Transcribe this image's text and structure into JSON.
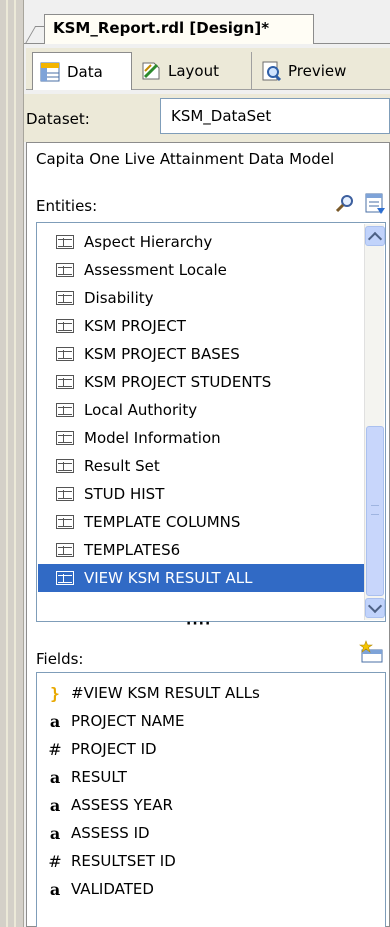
{
  "document_tab": {
    "title": "KSM_Report.rdl [Design]*"
  },
  "view_tabs": [
    {
      "label": "Data",
      "icon": "data-icon",
      "active": true
    },
    {
      "label": "Layout",
      "icon": "layout-icon",
      "active": false
    },
    {
      "label": "Preview",
      "icon": "preview-icon",
      "active": false
    }
  ],
  "dataset": {
    "label": "Dataset:",
    "value": "KSM_DataSet"
  },
  "model_title": "Capita One Live Attainment Data Model",
  "entities": {
    "label": "Entities:",
    "items": [
      {
        "label": "Aspect Hierarchy",
        "selected": false
      },
      {
        "label": "Assessment Locale",
        "selected": false
      },
      {
        "label": "Disability",
        "selected": false
      },
      {
        "label": "KSM PROJECT",
        "selected": false
      },
      {
        "label": "KSM PROJECT BASES",
        "selected": false
      },
      {
        "label": "KSM PROJECT STUDENTS",
        "selected": false
      },
      {
        "label": "Local Authority",
        "selected": false
      },
      {
        "label": "Model Information",
        "selected": false
      },
      {
        "label": "Result Set",
        "selected": false
      },
      {
        "label": "STUD HIST",
        "selected": false
      },
      {
        "label": "TEMPLATE COLUMNS",
        "selected": false
      },
      {
        "label": "TEMPLATES6",
        "selected": false
      },
      {
        "label": "VIEW KSM RESULT ALL",
        "selected": true
      }
    ]
  },
  "splitter": {
    "grip": "····"
  },
  "fields": {
    "label": "Fields:",
    "items": [
      {
        "type_glyph": "}",
        "type": "aggregate",
        "label": "#VIEW KSM RESULT ALLs"
      },
      {
        "type_glyph": "a",
        "type": "text",
        "label": "PROJECT NAME"
      },
      {
        "type_glyph": "#",
        "type": "number",
        "label": "PROJECT ID"
      },
      {
        "type_glyph": "a",
        "type": "text",
        "label": "RESULT"
      },
      {
        "type_glyph": "a",
        "type": "text",
        "label": "ASSESS YEAR"
      },
      {
        "type_glyph": "a",
        "type": "text",
        "label": "ASSESS ID"
      },
      {
        "type_glyph": "#",
        "type": "number",
        "label": "RESULTSET ID"
      },
      {
        "type_glyph": "a",
        "type": "text",
        "label": "VALIDATED"
      }
    ]
  },
  "colors": {
    "selection": "#316ac5",
    "tab_face": "#ece9d8",
    "border": "#7f9db9"
  }
}
